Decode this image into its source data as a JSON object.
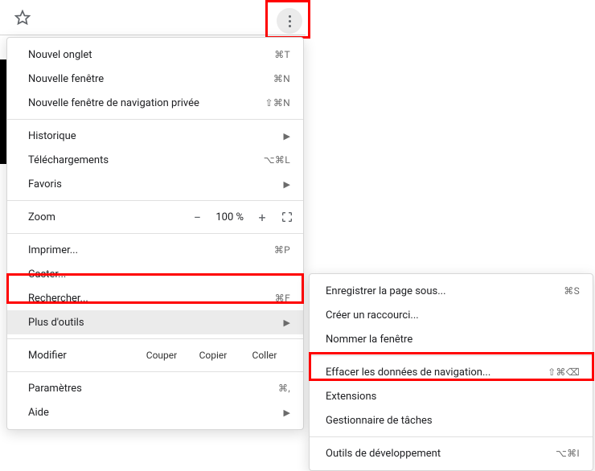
{
  "main_menu": {
    "new_tab": "Nouvel onglet",
    "new_tab_sc": "⌘T",
    "new_window": "Nouvelle fenêtre",
    "new_window_sc": "⌘N",
    "incognito": "Nouvelle fenêtre de navigation privée",
    "incognito_sc": "⇧⌘N",
    "history": "Historique",
    "downloads": "Téléchargements",
    "downloads_sc": "⌥⌘L",
    "bookmarks": "Favoris",
    "zoom": "Zoom",
    "zoom_value": "100 %",
    "minus": "−",
    "plus": "+",
    "print": "Imprimer...",
    "print_sc": "⌘P",
    "cast": "Caster...",
    "find": "Rechercher...",
    "find_sc": "⌘F",
    "more_tools": "Plus d'outils",
    "edit": "Modifier",
    "cut": "Couper",
    "copy": "Copier",
    "paste": "Coller",
    "settings": "Paramètres",
    "settings_sc": "⌘,",
    "help": "Aide"
  },
  "submenu": {
    "save_page": "Enregistrer la page sous...",
    "save_page_sc": "⌘S",
    "create_shortcut": "Créer un raccourci...",
    "name_window": "Nommer la fenêtre",
    "clear_data": "Effacer les données de navigation...",
    "clear_data_sc": "⇧⌘⌫",
    "extensions": "Extensions",
    "task_manager": "Gestionnaire de tâches",
    "dev_tools": "Outils de développement",
    "dev_tools_sc": "⌥⌘I"
  }
}
